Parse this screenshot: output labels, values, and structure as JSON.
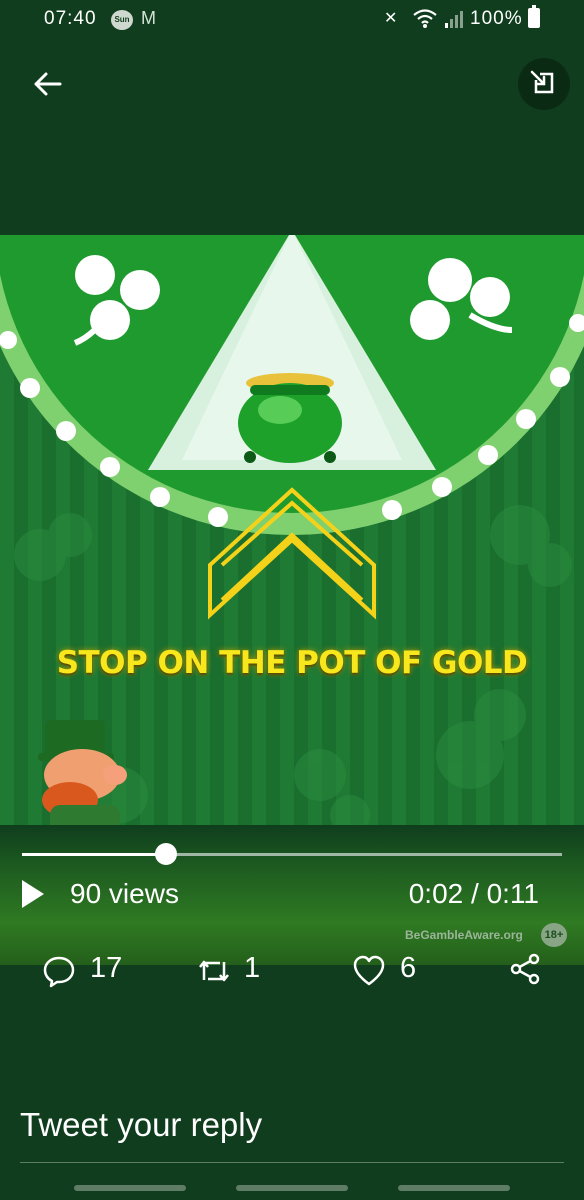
{
  "status_bar": {
    "time": "07:40",
    "battery": "100%",
    "notification_icons": [
      "sun-icon",
      "gmail-icon"
    ],
    "system_icons": [
      "mute-icon",
      "wifi-icon",
      "signal-icon",
      "battery-icon"
    ]
  },
  "header": {
    "back_icon": "arrow-left-icon",
    "pip_icon": "picture-in-picture-icon"
  },
  "video": {
    "promo_text": "STOP ON THE POT OF GOLD",
    "watermark": "BeGambleAware.org",
    "age_badge": "18+",
    "progress_fraction": 0.266,
    "views": "90 views",
    "time": "0:02 / 0:11"
  },
  "actions": {
    "replies": "17",
    "retweets": "1",
    "likes": "6"
  },
  "reply": {
    "placeholder": "Tweet your reply"
  },
  "colors": {
    "background": "#0f3d1d",
    "video_green": "#1f7a33",
    "promo_yellow": "#f8e71c"
  }
}
